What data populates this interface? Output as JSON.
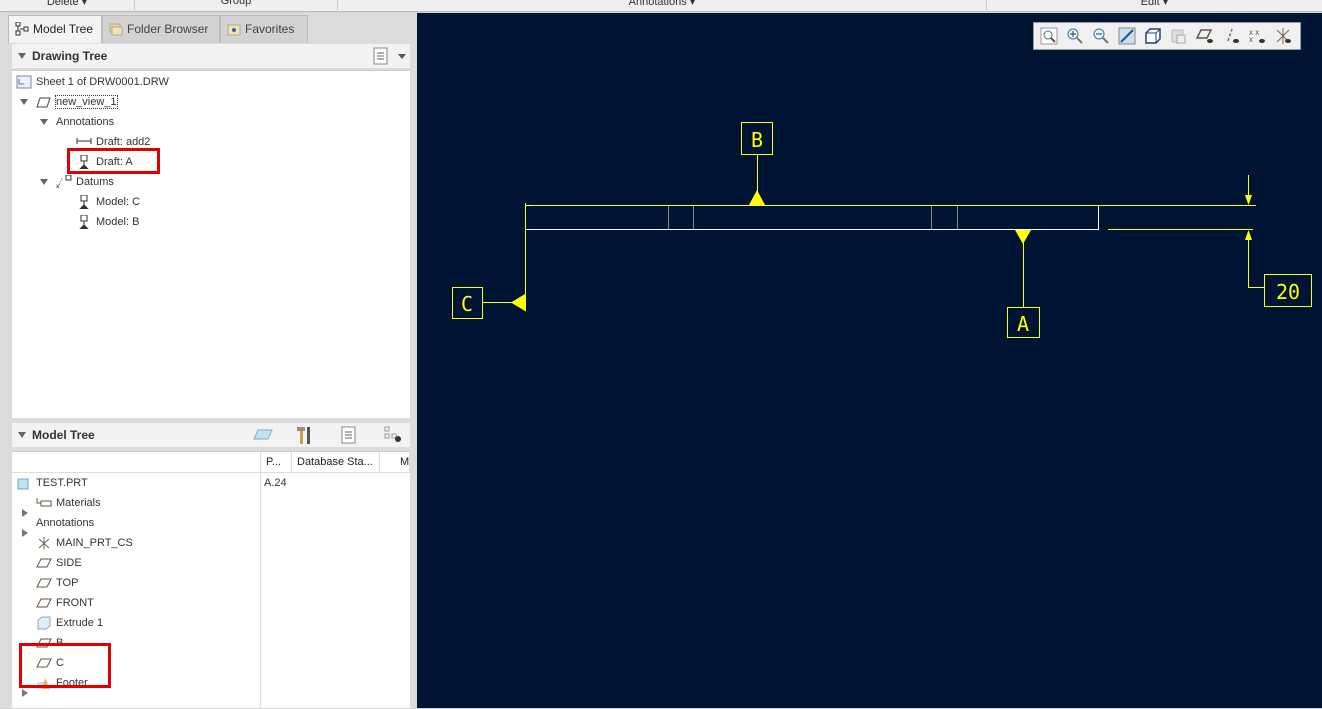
{
  "ribbon": {
    "groups": [
      "Delete ▾",
      "Group",
      "Annotations ▾",
      "Edit ▾"
    ]
  },
  "tabs": [
    {
      "label": "Model Tree",
      "active": true
    },
    {
      "label": "Folder Browser"
    },
    {
      "label": "Favorites"
    }
  ],
  "drawing_tree": {
    "title": "Drawing Tree",
    "items": [
      "Sheet 1 of DRW0001.DRW",
      "new_view_1",
      "Annotations",
      "Draft: add2",
      "Draft: A",
      "Datums",
      "Model: C",
      "Model: B"
    ]
  },
  "model_tree": {
    "title": "Model Tree",
    "columns": [
      "P...",
      "Database Sta...",
      "M"
    ],
    "items": [
      "TEST.PRT",
      "Materials",
      "Annotations",
      "MAIN_PRT_CS",
      "SIDE",
      "TOP",
      "FRONT",
      "Extrude 1",
      "B",
      "C",
      "Footer"
    ],
    "values": {
      "TEST.PRT": "A.24"
    },
    "test_value": "A.24"
  },
  "view_toolbar": [
    "refit-icon",
    "zoom-in-icon",
    "zoom-out-icon",
    "repaint-icon",
    "display-style-icon",
    "saved-views-icon",
    "plane-display-icon",
    "axis-display-icon",
    "point-display-icon",
    "csys-display-icon"
  ],
  "drawing": {
    "datum_b": "B",
    "datum_a": "A",
    "datum_c": "C",
    "dimension": "20"
  },
  "colors": {
    "canvas": "#001433",
    "annotation": "#ffff00",
    "highlight": "#e00000"
  }
}
